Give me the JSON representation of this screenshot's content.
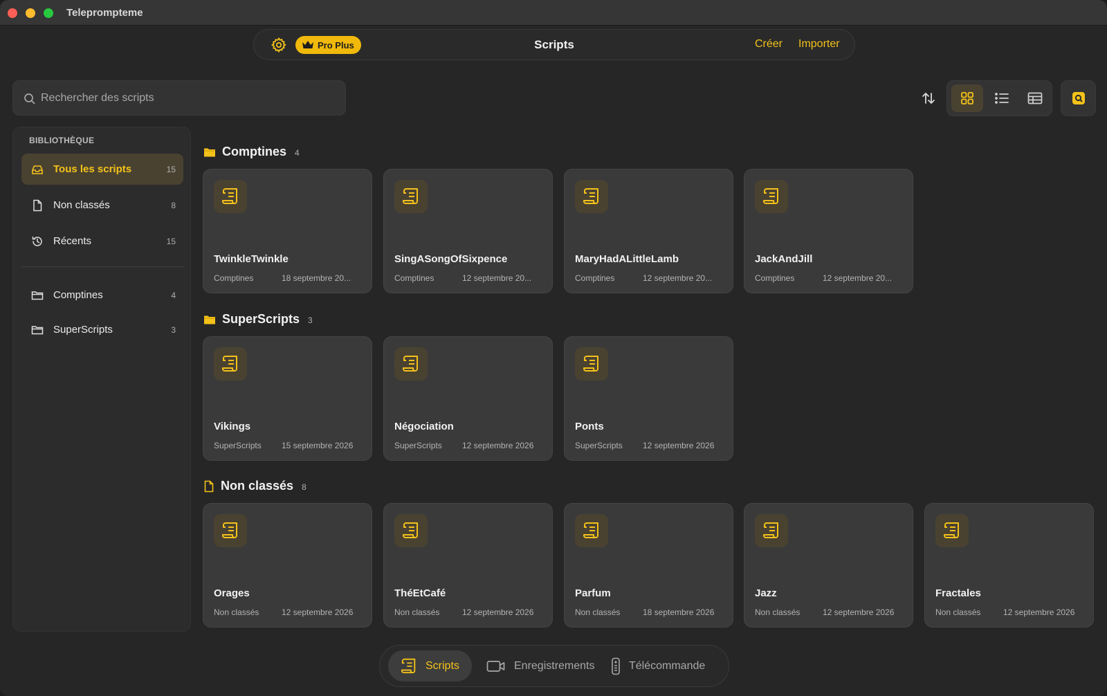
{
  "window": {
    "title": "Teleprompteme"
  },
  "topbar": {
    "badge_label": "Pro Plus",
    "page_title": "Scripts",
    "create_label": "Créer",
    "import_label": "Importer"
  },
  "search": {
    "placeholder": "Rechercher des scripts"
  },
  "sidebar": {
    "heading": "BIBLIOTHÈQUE",
    "items": [
      {
        "label": "Tous les scripts",
        "count": "15",
        "icon": "tray-icon"
      },
      {
        "label": "Non classés",
        "count": "8",
        "icon": "document-icon"
      },
      {
        "label": "Récents",
        "count": "15",
        "icon": "history-icon"
      }
    ],
    "folders": [
      {
        "label": "Comptines",
        "count": "4",
        "icon": "folder-icon"
      },
      {
        "label": "SuperScripts",
        "count": "3",
        "icon": "folder-icon"
      }
    ]
  },
  "sections": [
    {
      "title": "Comptines",
      "count": "4",
      "cards": [
        {
          "title": "TwinkleTwinkle",
          "folder": "Comptines",
          "date": "18 septembre 20..."
        },
        {
          "title": "SingASongOfSixpence",
          "folder": "Comptines",
          "date": "12 septembre 20..."
        },
        {
          "title": "MaryHadALittleLamb",
          "folder": "Comptines",
          "date": "12 septembre 20..."
        },
        {
          "title": "JackAndJill",
          "folder": "Comptines",
          "date": "12 septembre 20..."
        }
      ]
    },
    {
      "title": "SuperScripts",
      "count": "3",
      "cards": [
        {
          "title": "Vikings",
          "folder": "SuperScripts",
          "date": "15 septembre 2026"
        },
        {
          "title": "Négociation",
          "folder": "SuperScripts",
          "date": "12 septembre 2026"
        },
        {
          "title": "Ponts",
          "folder": "SuperScripts",
          "date": "12 septembre 2026"
        }
      ]
    },
    {
      "title": "Non classés",
      "count": "8",
      "cards": [
        {
          "title": "Orages",
          "folder": "Non classés",
          "date": "12 septembre 2026"
        },
        {
          "title": "ThéEtCafé",
          "folder": "Non classés",
          "date": "12 septembre 2026"
        },
        {
          "title": "Parfum",
          "folder": "Non classés",
          "date": "18 septembre 2026"
        },
        {
          "title": "Jazz",
          "folder": "Non classés",
          "date": "12 septembre 2026"
        },
        {
          "title": "Fractales",
          "folder": "Non classés",
          "date": "12 septembre 2026"
        }
      ]
    }
  ],
  "bottom_tabs": [
    {
      "label": "Scripts",
      "icon": "scroll-icon"
    },
    {
      "label": "Enregistrements",
      "icon": "video-camera-icon"
    },
    {
      "label": "Télécommande",
      "icon": "remote-icon"
    }
  ],
  "colors": {
    "accent": "#f4c21a",
    "badge": "#f0b90b",
    "active_bg": "#4a4231"
  }
}
